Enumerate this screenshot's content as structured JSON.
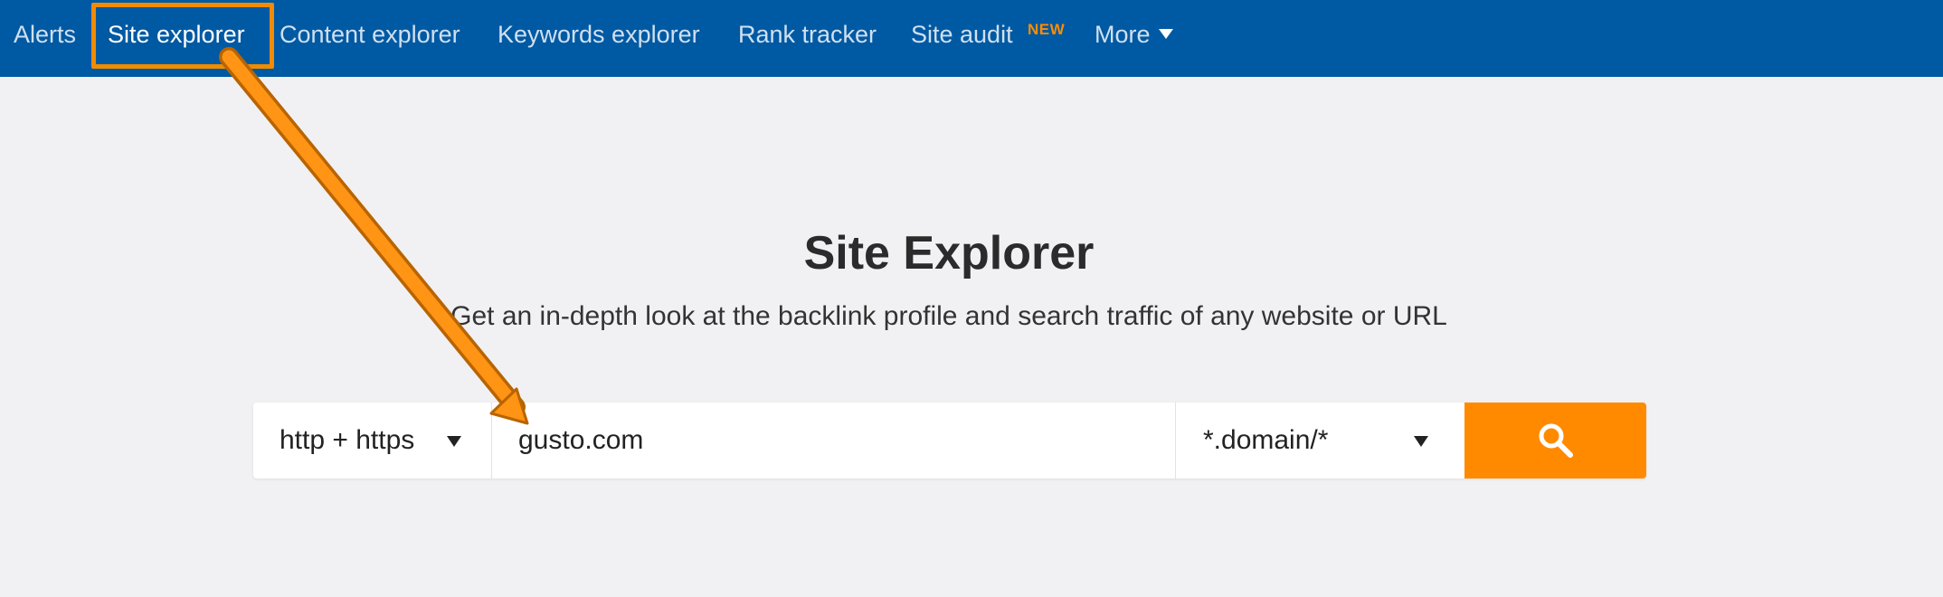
{
  "nav": {
    "items": [
      {
        "label": "Alerts"
      },
      {
        "label": "Site explorer",
        "active": true
      },
      {
        "label": "Content explorer"
      },
      {
        "label": "Keywords explorer"
      },
      {
        "label": "Rank tracker"
      },
      {
        "label": "Site audit",
        "badge": "NEW"
      },
      {
        "label": "More"
      }
    ]
  },
  "main": {
    "title": "Site Explorer",
    "subtitle": "Get an in-depth look at the backlink profile and search traffic of any website or URL"
  },
  "search": {
    "protocol": "http + https",
    "url_value": "gusto.com",
    "mode": "*.domain/*",
    "button_icon": "search-icon"
  },
  "colors": {
    "nav_bg": "#0059a3",
    "accent": "#ff8a00",
    "page_bg": "#f1f1f4"
  }
}
